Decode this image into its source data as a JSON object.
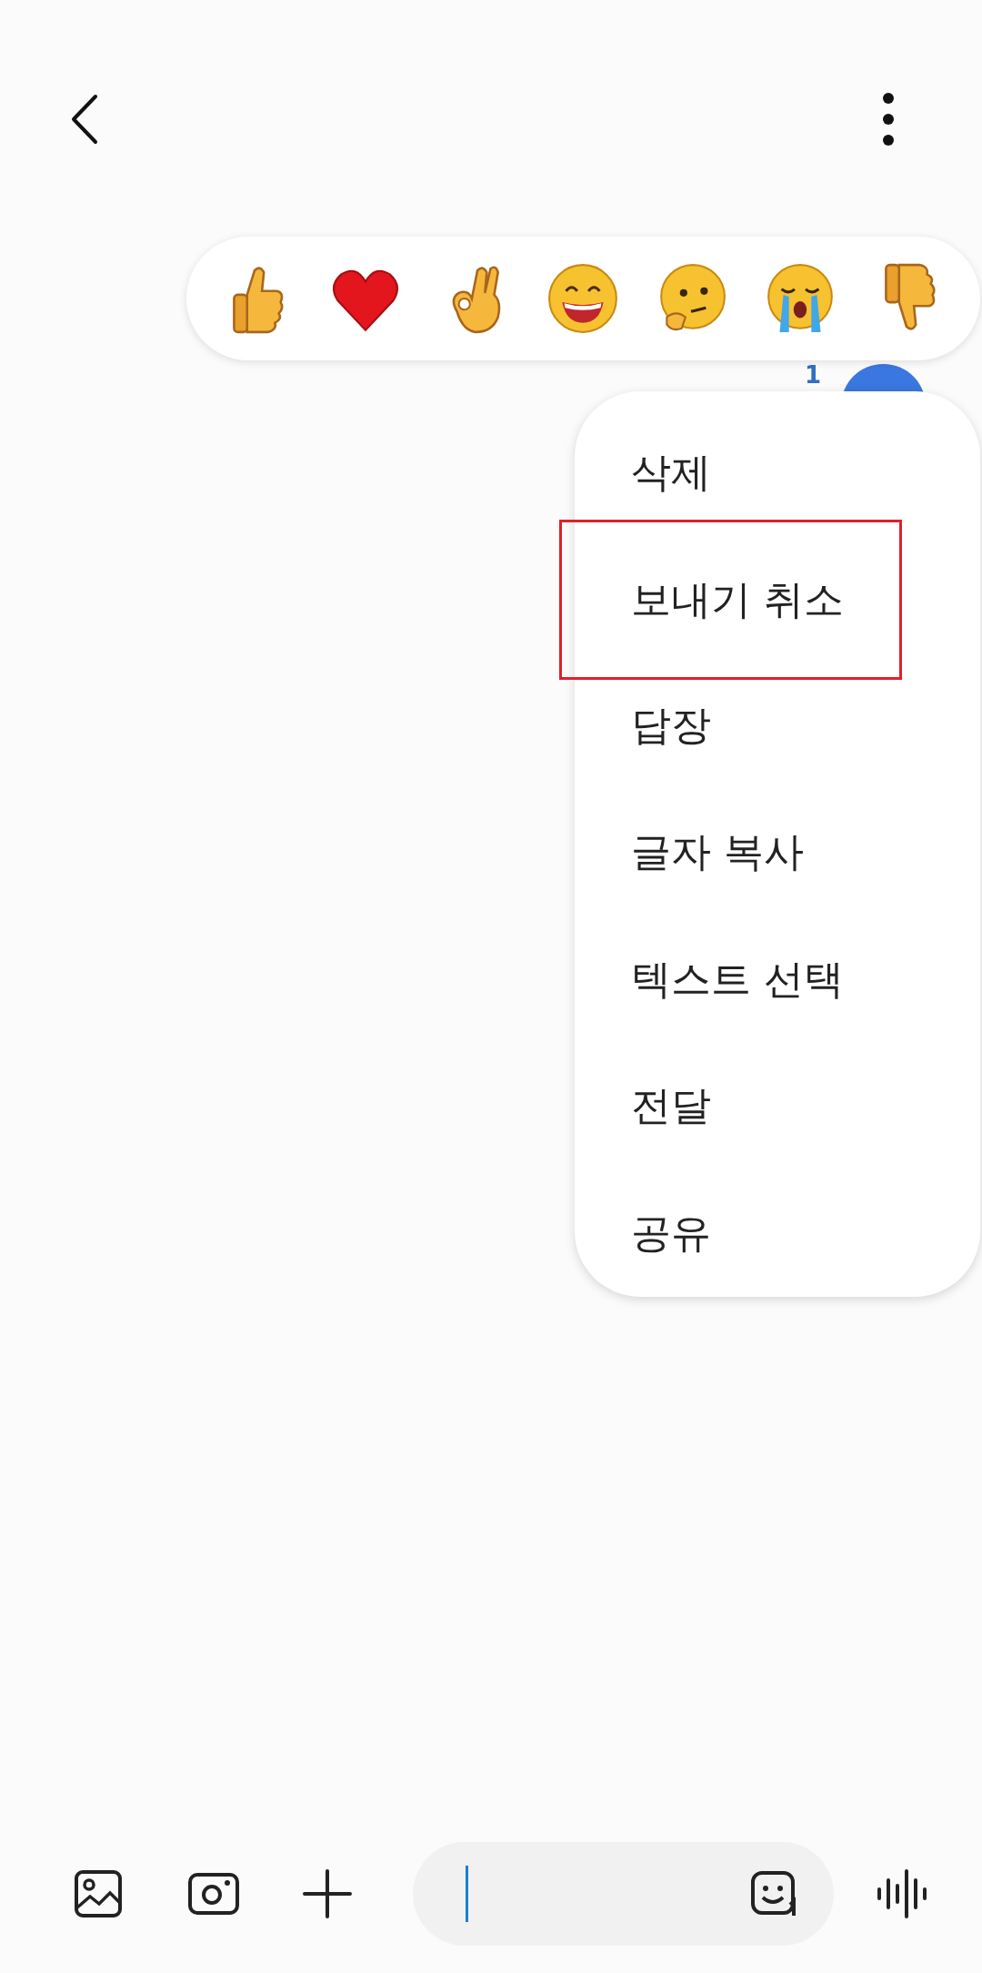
{
  "message": {
    "read_count": "1"
  },
  "reactions": [
    {
      "kind": "thumbs_up"
    },
    {
      "kind": "heart"
    },
    {
      "kind": "ok_hand"
    },
    {
      "kind": "grin"
    },
    {
      "kind": "thinking"
    },
    {
      "kind": "crying"
    },
    {
      "kind": "thumbs_down"
    }
  ],
  "context_menu": {
    "items": [
      {
        "label": "삭제",
        "highlighted": false
      },
      {
        "label": "보내기 취소",
        "highlighted": true
      },
      {
        "label": "답장",
        "highlighted": false
      },
      {
        "label": "글자 복사",
        "highlighted": false
      },
      {
        "label": "텍스트 선택",
        "highlighted": false
      },
      {
        "label": "전달",
        "highlighted": false
      },
      {
        "label": "공유",
        "highlighted": false
      }
    ]
  }
}
